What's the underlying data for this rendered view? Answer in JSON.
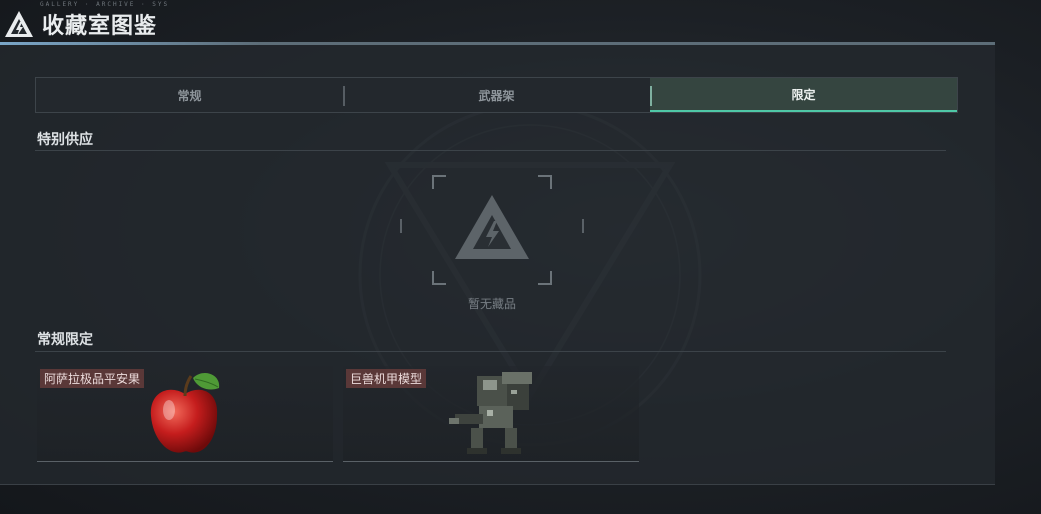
{
  "header": {
    "title": "收藏室图鉴",
    "micro_text": "GALLERY · ARCHIVE · SYS"
  },
  "tabs": [
    {
      "label": "常规",
      "active": false
    },
    {
      "label": "武器架",
      "active": false
    },
    {
      "label": "限定",
      "active": true
    }
  ],
  "sections": {
    "special_supply": {
      "title": "特别供应",
      "empty_text": "暂无藏品"
    },
    "regular_limited": {
      "title": "常规限定",
      "items": [
        {
          "name": "阿萨拉极品平安果",
          "icon": "apple-icon"
        },
        {
          "name": "巨兽机甲模型",
          "icon": "mech-model-icon"
        }
      ]
    }
  },
  "colors": {
    "accent": "#4fc8a7",
    "active_tab_bg": "#354540",
    "item_tag_bg": "#5a3838"
  }
}
